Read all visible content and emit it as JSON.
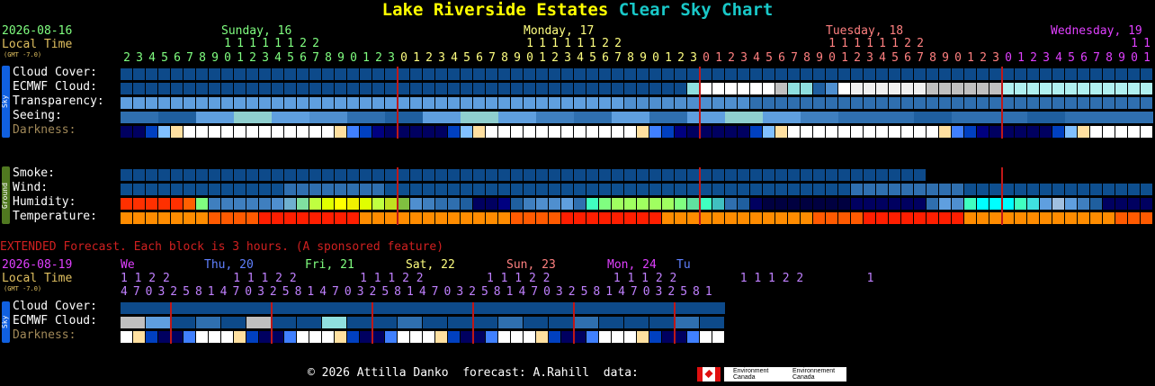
{
  "title": {
    "site": "Lake Riverside Estates",
    "chart": "Clear Sky Chart",
    "site_color": "#ffff00",
    "chart_color": "#19c8c8"
  },
  "header": {
    "date": "2026-08-16",
    "local_time": "Local Time",
    "gmt": "(GMT -7.0)",
    "days": [
      {
        "label": "Sunday, 16",
        "color": "#80ff80"
      },
      {
        "label": "Monday, 17",
        "color": "#ffff80"
      },
      {
        "label": "Tuesday, 18",
        "color": "#ff8080"
      },
      {
        "label": "Wednesday, 19",
        "color": "#e040ff"
      }
    ],
    "hour_tens_row1": "           1 1 1 1 1 1 1 1 1 1 1 1 2 2 2 2                       1 1 1 1 1 1 1 1 1 1 1 1 2 2 2 2                       1 1 1 1 1 1 1 1 1 1 1 1 2 2 2 2                       1 1",
    "hours": [
      "2",
      "3",
      "4",
      "5",
      "6",
      "7",
      "8",
      "9",
      "0",
      "1",
      "2",
      "3",
      "4",
      "5",
      "6",
      "7",
      "8",
      "9",
      "0",
      "1",
      "2",
      "3",
      "0",
      "1",
      "2",
      "3",
      "4",
      "5",
      "6",
      "7",
      "8",
      "9",
      "0",
      "1",
      "2",
      "3",
      "4",
      "5",
      "6",
      "7",
      "8",
      "9",
      "0",
      "1",
      "2",
      "3",
      "0",
      "1",
      "2",
      "3",
      "4",
      "5",
      "6",
      "7",
      "8",
      "9",
      "0",
      "1",
      "2",
      "3",
      "4",
      "5",
      "6",
      "7",
      "8",
      "9",
      "0",
      "1",
      "2",
      "3",
      "0",
      "1",
      "2",
      "3",
      "4",
      "5",
      "6",
      "7",
      "8",
      "9",
      "0",
      "1"
    ]
  },
  "rows": {
    "cloud_cover": "Cloud Cover:",
    "ecmwf_cloud": "ECMWF Cloud:",
    "transparency": "Transparency:",
    "seeing": "Seeing:",
    "darkness": "Darkness:",
    "smoke": "Smoke:",
    "wind": "Wind:",
    "humidity": "Humidity:",
    "temperature": "Temperature:"
  },
  "sidebars": {
    "sky": "Sky",
    "ground": "Ground"
  },
  "extended": {
    "banner": "EXTENDED Forecast. Each block is 3 hours. (A sponsored feature)",
    "date": "2026-08-19",
    "local_time": "Local Time",
    "gmt": "(GMT -7.0)",
    "days": [
      {
        "label": "We",
        "color": "#e040ff"
      },
      {
        "label": "Thu, 20",
        "color": "#6080ff"
      },
      {
        "label": "Fri, 21",
        "color": "#80ff80"
      },
      {
        "label": "Sat, 22",
        "color": "#ffff80"
      },
      {
        "label": "Sun, 23",
        "color": "#ff8080"
      },
      {
        "label": "Mon, 24",
        "color": "#e040ff"
      },
      {
        "label": "Tu",
        "color": "#6080ff"
      }
    ],
    "tens": "1 1 2 2         1 1 1 2 2         1 1 1 2 2         1 1 1 2 2         1 1 1 2 2         1 1 1 2 2         1",
    "hours": "4 7 0 3 2 5 8 1 4 7 0 3 2 5 8 1 4 7 0 3 2 5 8 1 4 7 0 3 2 5 8 1 4 7 0 3 2 5 8 1 4 7 0 3 2 5 8 1",
    "cloud_cover": "Cloud Cover:",
    "ecmwf_cloud": "ECMWF Cloud:",
    "darkness": "Darkness:"
  },
  "footer": {
    "copyright": "© 2026 Attilla Danko",
    "forecast": "forecast: A.Rahill",
    "data": "data:",
    "env1": "Environment Canada",
    "env2": "Environnement Canada"
  },
  "colors": {
    "navy": "#003f7f",
    "blue1": "#0e4f8f",
    "blue2": "#1f5f9f",
    "blue3": "#2f6faf",
    "blue4": "#3f7fbf",
    "blue5": "#4f8fcf",
    "blue6": "#5f9fdf",
    "cyanish": "#8fdfdf",
    "white": "#ffffff",
    "lgray": "#c0c0c0",
    "dark": "#000033",
    "red_line": "#c01818"
  }
}
